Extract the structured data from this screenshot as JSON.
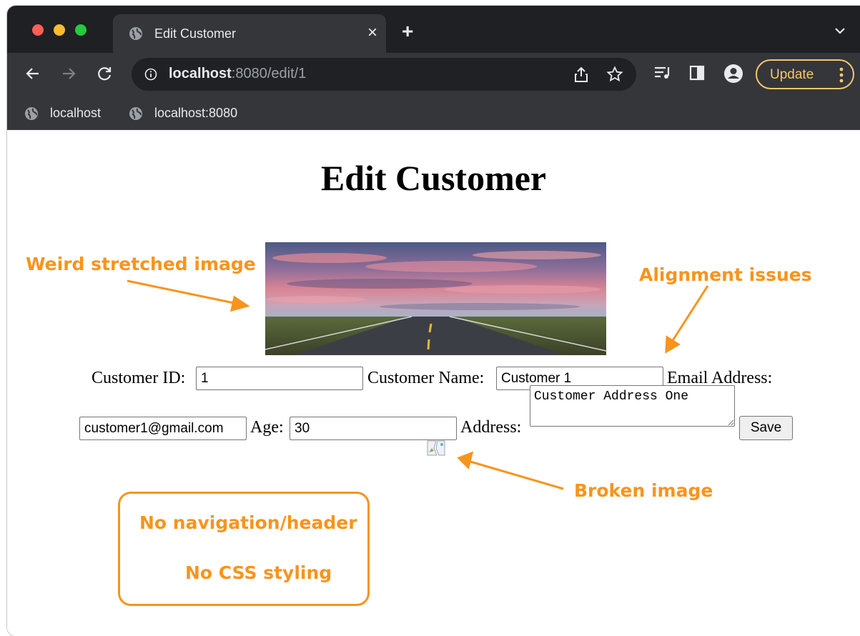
{
  "browser": {
    "tab_title": "Edit Customer",
    "tab_close": "×",
    "new_tab": "+",
    "url_host": "localhost",
    "url_rest": ":8080/edit/1",
    "update_label": "Update",
    "bookmarks": [
      {
        "label": "localhost"
      },
      {
        "label": "localhost:8080"
      }
    ]
  },
  "page": {
    "title": "Edit Customer",
    "form": {
      "customer_id_label": "Customer ID:",
      "customer_id_value": "1",
      "customer_name_label": "Customer Name:",
      "customer_name_value": "Customer 1",
      "email_label": "Email Address:",
      "email_value": "customer1@gmail.com",
      "age_label": "Age:",
      "age_value": "30",
      "address_label": "Address:",
      "address_value": "Customer Address One",
      "save_label": "Save"
    }
  },
  "annotations": {
    "stretched_image": "Weird stretched image",
    "alignment": "Alignment issues",
    "broken_image": "Broken image",
    "no_navigation": "No navigation/header",
    "no_css": "No CSS styling"
  },
  "colors": {
    "annotation": "#f7941d",
    "chrome_dark": "#1f2023",
    "chrome_tab": "#35363a",
    "update_accent": "#f6c86a"
  }
}
